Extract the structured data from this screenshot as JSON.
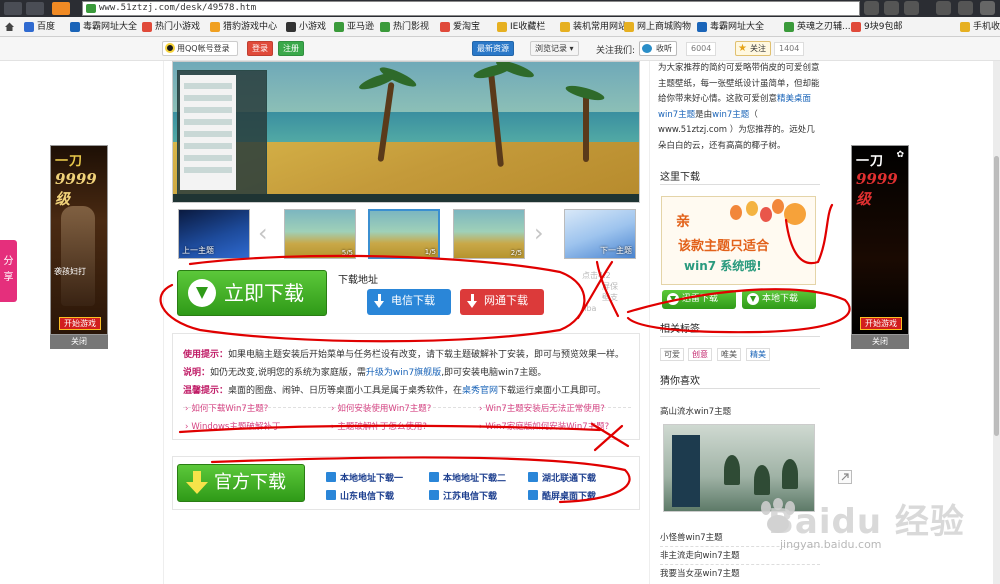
{
  "browser": {
    "url": "www.51ztzj.com/desk/49578.htm",
    "bookmarks": [
      {
        "label": "百度",
        "color": "#2f6ad0"
      },
      {
        "label": "毒霸网址大全",
        "color": "#1a64b8"
      },
      {
        "label": "热门小游戏",
        "color": "#e04a3a"
      },
      {
        "label": "猎豹游戏中心",
        "color": "#f0a021"
      },
      {
        "label": "小游戏",
        "color": "#333333"
      },
      {
        "label": "亚马逊",
        "color": "#3a9a3a"
      },
      {
        "label": "热门影视",
        "color": "#3a9a3a"
      },
      {
        "label": "爱淘宝",
        "color": "#e04a3a"
      },
      {
        "label": "IE收藏栏",
        "color": "#e6b021"
      },
      {
        "label": "装机常用网站",
        "color": "#e6b021"
      },
      {
        "label": "网上商城购物",
        "color": "#e6b021"
      },
      {
        "label": "毒霸网址大全",
        "color": "#1a64b8"
      },
      {
        "label": "英魂之刃辅...",
        "color": "#3a9a3a"
      },
      {
        "label": "9块9包邮",
        "color": "#e04a3a"
      },
      {
        "label": "手机收藏",
        "color": "#e6b021"
      }
    ]
  },
  "toolbar": {
    "qq_login": "用QQ帐号登录",
    "login": "登录",
    "register": "注册",
    "latest": "最新资源",
    "history": "浏览记录",
    "follow_us": "关注我们:",
    "listen": "收听",
    "listen_count": "6004",
    "follow": "关注",
    "follow_count": "1404"
  },
  "ads": {
    "left_title1": "一刀",
    "left_title2": "9999 级",
    "left_text": "袭孩妇打",
    "play": "开始游戏",
    "close": "关闭"
  },
  "share": "分享",
  "thumbs": {
    "prev_label": "上一主题",
    "next_label": "下一主题",
    "captions": [
      "5/5",
      "1/5",
      "2/5"
    ]
  },
  "download": {
    "big_button": "立即下载",
    "address_label": "下载地址",
    "telecom": "电信下载",
    "netcom": "网通下载",
    "ghost_text": [
      "点击4.2",
      "屏保",
      "壁支",
      "llba"
    ]
  },
  "tips": {
    "use_key": "使用提示：",
    "use_text": "如果电脑主题安装后开始菜单与任务栏设有改变，请下载主题破解补丁安装，即可与预览效果一样。",
    "note_key": "说明：",
    "note_text_a": "如仍无改变,说明您的系统为家庭版，需",
    "note_link": "升级为win7旗舰版",
    "note_text_b": ",即可安装电脑win7主题。",
    "warm_key": "温馨提示：",
    "warm_text_a": "桌面的图盘、闹钟、日历等桌面小工具是属于桌秀软件，在",
    "warm_link": "桌秀官网",
    "warm_text_b": "下载运行桌面小工具即可。",
    "qa": [
      "如何下载Win7主题?",
      "如何安装使用Win7主题?",
      "Win7主题安装后无法正常使用?",
      "Windows主题破解补丁",
      "主题破解补丁怎么使用?",
      "Win7家庭版如何安装Win7主题?"
    ]
  },
  "official": {
    "button": "官方下载",
    "links": [
      "本地地址下载一",
      "本地地址下载二",
      "湖北联通下载",
      "山东电信下载",
      "江苏电信下载",
      "酷屏桌面下载"
    ]
  },
  "sidebar": {
    "intro_a": "为大家推荐的简约可爱略带俏皮的可爱创意主题壁纸，每一张壁纸设计虽简单，但却能给你带来好心情。这款可爱创意",
    "intro_link": "精美桌面win7主题",
    "intro_b": "是由",
    "intro_link2": "win7主题",
    "intro_c": "（ www.51ztzj.com ）为您推荐的。远处几朵白白的云，还有高高的椰子树。",
    "here_download": "这里下载",
    "qr_line1": "亲",
    "qr_line2": "该款主题只适合",
    "qr_line3": "win7 系统哦!",
    "xunlei": "迅雷下载",
    "local": "本地下载",
    "related_tags": "相关标签",
    "tags": [
      "可爱",
      "创意",
      "唯美",
      "精美"
    ],
    "guess": "猜你喜欢",
    "guess_items": [
      "高山流水win7主题",
      "小怪兽win7主题",
      "非主流走向win7主题",
      "我要当女巫win7主题"
    ]
  },
  "watermark": {
    "brand": "Baidu 经验",
    "sub": "jingyan.baidu.com"
  },
  "colors": {
    "green": "#2f9a18",
    "blue_btn": "#2a86d8",
    "red_btn": "#dc3a3a",
    "annotation": "#e00000"
  }
}
